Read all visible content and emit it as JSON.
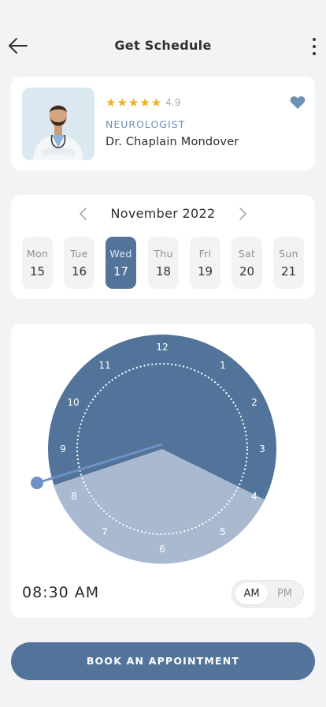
{
  "header": {
    "title": "Get Schedule",
    "back_icon": "arrow-left-icon",
    "more_icon": "more-vertical-icon"
  },
  "doctor": {
    "rating": "4.9",
    "stars": 5,
    "specialty": "NEUROLOGIST",
    "name": "Dr. Chaplain Mondover",
    "favorite_icon": "heart-icon"
  },
  "calendar": {
    "month": "November 2022",
    "days": [
      {
        "name": "Mon",
        "num": "15"
      },
      {
        "name": "Tue",
        "num": "16"
      },
      {
        "name": "Wed",
        "num": "17"
      },
      {
        "name": "Thu",
        "num": "18"
      },
      {
        "name": "Fri",
        "num": "19"
      },
      {
        "name": "Sat",
        "num": "20"
      },
      {
        "name": "Sun",
        "num": "21"
      }
    ],
    "selected_day": "17"
  },
  "clock": {
    "numbers": [
      "12",
      "1",
      "2",
      "3",
      "4",
      "5",
      "6",
      "7",
      "8",
      "9",
      "10",
      "11"
    ],
    "time": "08:30 AM",
    "am_label": "AM",
    "pm_label": "PM",
    "selected_period": "AM"
  },
  "book_button": "BOOK AN APPOINTMENT",
  "colors": {
    "accent": "#53749a",
    "accent_light": "#a9b9d0",
    "star": "#f2b01e",
    "specialty": "#6f90b6",
    "background": "#f2f3f5"
  }
}
